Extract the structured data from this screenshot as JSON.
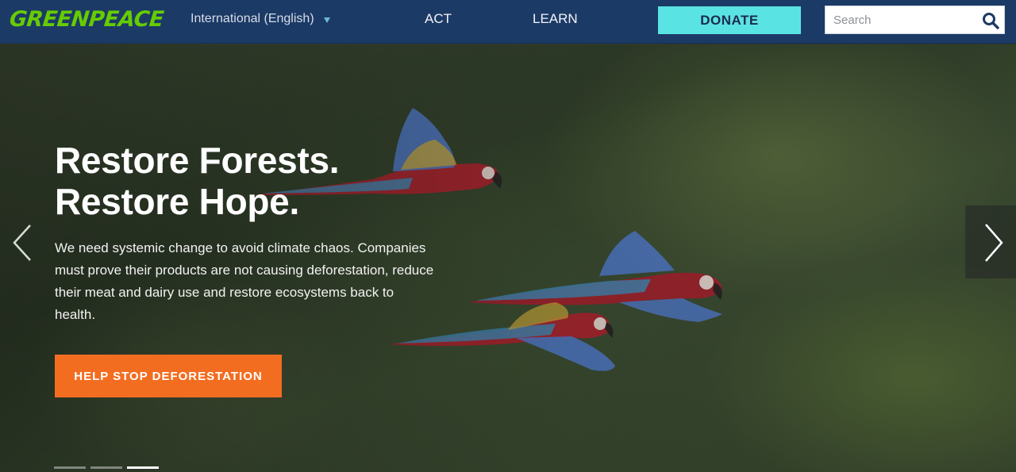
{
  "header": {
    "logo_text": "GREENPEACE",
    "logo_color": "#66cc00",
    "language": "International (English)",
    "nav": [
      {
        "label": "ACT"
      },
      {
        "label": "LEARN"
      }
    ],
    "donate_label": "DONATE",
    "donate_color": "#5ae3e3",
    "search_placeholder": "Search",
    "search_icon": "search-icon",
    "background_color": "#1c3a66"
  },
  "hero": {
    "title_line1": "Restore Forests.",
    "title_line2": "Restore Hope.",
    "body": "We need systemic change to avoid climate chaos. Companies must prove their products are not causing deforestation, reduce their meat and dairy use and restore ecosystems back to health.",
    "cta_label": "HELP STOP DEFORESTATION",
    "cta_color": "#f36d21",
    "prev_icon": "chevron-left-icon",
    "next_icon": "chevron-right-icon",
    "slides_total": 3,
    "active_slide": 3
  }
}
